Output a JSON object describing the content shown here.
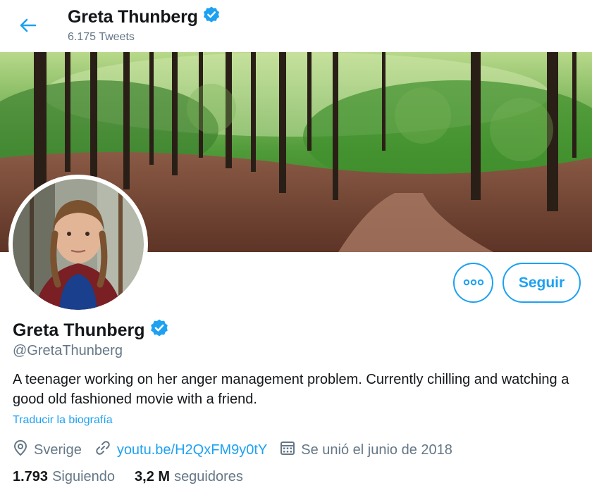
{
  "header": {
    "name": "Greta Thunberg",
    "tweet_count": "6.175 Tweets"
  },
  "profile": {
    "name": "Greta Thunberg",
    "handle": "@GretaThunberg",
    "bio": "A teenager working on her anger management problem. Currently chilling and watching a good old fashioned movie with a friend.",
    "translate_label": "Traducir la biografía",
    "location": "Sverige",
    "website": "youtu.be/H2QxFM9y0tY",
    "joined": "Se unió el junio de 2018"
  },
  "actions": {
    "follow_label": "Seguir"
  },
  "stats": {
    "following_count": "1.793",
    "following_label": "Siguiendo",
    "followers_count": "3,2 M",
    "followers_label": "seguidores"
  },
  "colors": {
    "accent": "#1da1f2",
    "secondary_text": "#657786",
    "primary_text": "#14171a"
  },
  "icons": [
    "back-arrow-icon",
    "verified-badge-icon",
    "more-options-icon",
    "location-pin-icon",
    "link-icon",
    "calendar-icon"
  ]
}
